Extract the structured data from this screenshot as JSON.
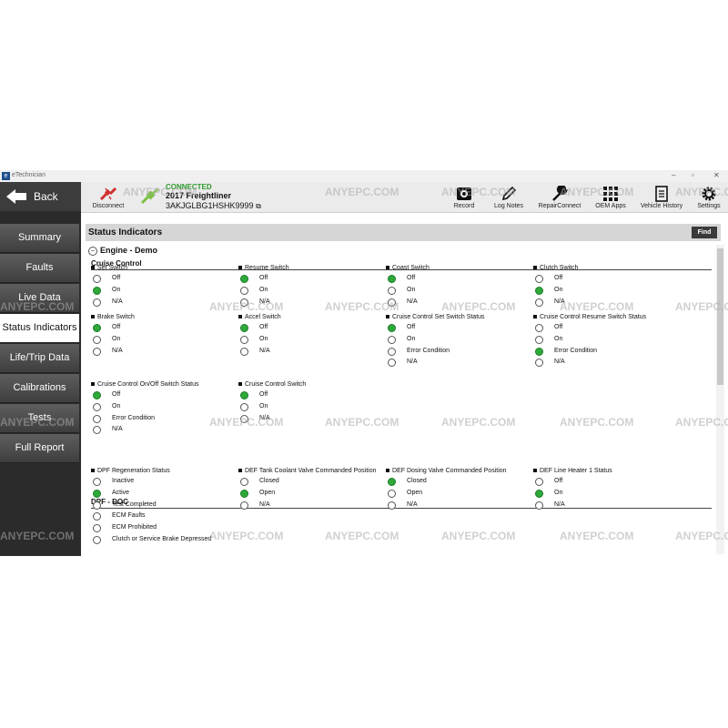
{
  "window": {
    "title": "eTechnician"
  },
  "sidebar": {
    "back_label": "Back",
    "items": [
      {
        "label": "Summary"
      },
      {
        "label": "Faults"
      },
      {
        "label": "Live Data"
      },
      {
        "label": "Status Indicators"
      },
      {
        "label": "Life/Trip Data"
      },
      {
        "label": "Calibrations"
      },
      {
        "label": "Tests"
      },
      {
        "label": "Full Report"
      }
    ]
  },
  "toolbar": {
    "disconnect_label": "Disconnect",
    "connection_status": "CONNECTED",
    "vehicle_name": "2017 Freightliner",
    "vin": "3AKJGLBG1HSHK9999",
    "actions": [
      {
        "label": "Record",
        "icon": "record-icon"
      },
      {
        "label": "Log Notes",
        "icon": "pen-icon"
      },
      {
        "label": "RepairConnect",
        "icon": "wrench-icon"
      },
      {
        "label": "OEM Apps",
        "icon": "grid-icon"
      },
      {
        "label": "Vehicle History",
        "icon": "document-icon"
      },
      {
        "label": "Settings",
        "icon": "gear-icon"
      }
    ]
  },
  "page": {
    "title": "Status Indicators",
    "find_label": "Find",
    "group_title": "Engine - Demo",
    "sections": [
      {
        "title": "Cruise Control",
        "blocks": [
          {
            "title": "Set Switch",
            "options": [
              "Off",
              "On",
              "N/A"
            ],
            "selected": 1
          },
          {
            "title": "Resume Switch",
            "options": [
              "Off",
              "On",
              "N/A"
            ],
            "selected": 0
          },
          {
            "title": "Coast Switch",
            "options": [
              "Off",
              "On",
              "N/A"
            ],
            "selected": 0
          },
          {
            "title": "Clutch Switch",
            "options": [
              "Off",
              "On",
              "N/A"
            ],
            "selected": 1
          },
          {
            "title": "Brake Switch",
            "options": [
              "Off",
              "On",
              "N/A"
            ],
            "selected": 0
          },
          {
            "title": "Accel Switch",
            "options": [
              "Off",
              "On",
              "N/A"
            ],
            "selected": 0
          },
          {
            "title": "Cruise Control Set Switch Status",
            "options": [
              "Off",
              "On",
              "Error Condition",
              "N/A"
            ],
            "selected": 0
          },
          {
            "title": "Cruise Control Resume Switch Status",
            "options": [
              "Off",
              "On",
              "Error Condition",
              "N/A"
            ],
            "selected": 2
          },
          {
            "title": "Cruise Control On/Off Switch Status",
            "options": [
              "Off",
              "On",
              "Error Condition",
              "N/A"
            ],
            "selected": 0
          },
          {
            "title": "Cruise Control Switch",
            "options": [
              "Off",
              "On",
              "N/A"
            ],
            "selected": 0
          }
        ]
      },
      {
        "title": "DPF - DOC",
        "blocks": [
          {
            "title": "DPF Regeneration Status",
            "options": [
              "Inactive",
              "Active",
              "Test Completed",
              "ECM Faults",
              "ECM Prohibited",
              "Clutch or Service Brake Depressed"
            ],
            "selected": 1
          },
          {
            "title": "DEF Tank Coolant Valve Commanded Position",
            "options": [
              "Closed",
              "Open",
              "N/A"
            ],
            "selected": 1
          },
          {
            "title": "DEF Dosing Valve Commanded Position",
            "options": [
              "Closed",
              "Open",
              "N/A"
            ],
            "selected": 0
          },
          {
            "title": "DEF Line Heater 1 Status",
            "options": [
              "Off",
              "On",
              "N/A"
            ],
            "selected": 1
          }
        ]
      }
    ]
  },
  "watermark": {
    "text": "ANYEPC.COM",
    "badge": "AE"
  },
  "colors": {
    "selected_radio": "#2eaa3a",
    "connected": "#2e9a2e",
    "disconnect": "#d12f2f"
  }
}
